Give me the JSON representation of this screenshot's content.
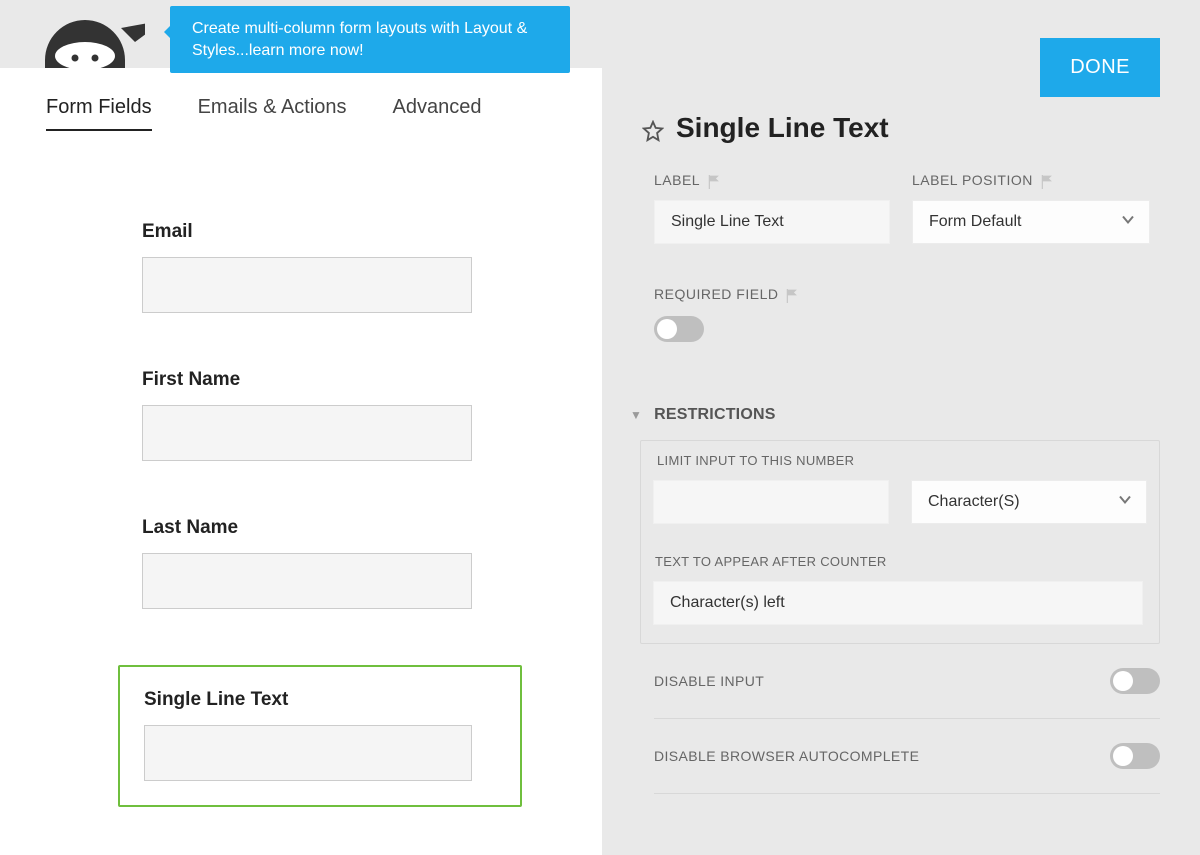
{
  "promo_text": "Create multi-column form layouts with Layout & Styles...learn more now!",
  "tabs": [
    {
      "label": "Form Fields",
      "active": true
    },
    {
      "label": "Emails & Actions",
      "active": false
    },
    {
      "label": "Advanced",
      "active": false
    }
  ],
  "form_fields": [
    {
      "label": "Email",
      "selected": false
    },
    {
      "label": "First Name",
      "selected": false
    },
    {
      "label": "Last Name",
      "selected": false
    },
    {
      "label": "Single Line Text",
      "selected": true
    }
  ],
  "drawer": {
    "done_button": "DONE",
    "title": "Single Line Text",
    "label_setting": {
      "label": "LABEL",
      "value": "Single Line Text"
    },
    "label_position": {
      "label": "LABEL POSITION",
      "value": "Form Default"
    },
    "required_field": {
      "label": "REQUIRED FIELD",
      "on": false
    },
    "restrictions": {
      "title": "RESTRICTIONS",
      "limit_label": "LIMIT INPUT TO THIS NUMBER",
      "limit_value": "",
      "limit_unit": "Character(S)",
      "counter_label": "TEXT TO APPEAR AFTER COUNTER",
      "counter_value": "Character(s) left"
    },
    "disable_input": {
      "label": "DISABLE INPUT",
      "on": false
    },
    "disable_autocomplete": {
      "label": "DISABLE BROWSER AUTOCOMPLETE",
      "on": false
    }
  }
}
